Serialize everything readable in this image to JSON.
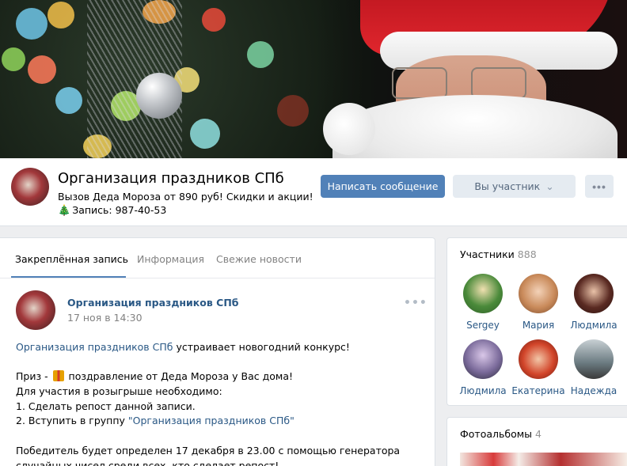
{
  "header": {
    "group_name": "Организация праздников СПб",
    "status": "Вызов Деда Мороза от 890 руб! Скидки и акции!",
    "phone_icon": "🎄",
    "phone": "Запись: 987-40-53",
    "write_button": "Написать сообщение",
    "member_button": "Вы участник",
    "member_chevron": "⌄",
    "more_button": "•••"
  },
  "tabs": [
    {
      "label": "Закреплённая запись",
      "active": true
    },
    {
      "label": "Информация",
      "active": false
    },
    {
      "label": "Свежие новости",
      "active": false
    }
  ],
  "post": {
    "author": "Организация праздников СПб",
    "date": "17 ноя в 14:30",
    "more": "•••",
    "line1_link": "Организация праздников СПб",
    "line1_rest": " устраивает новогодний конкурс!",
    "line2_a": "Приз - ",
    "line2_b": " поздравление от Деда Мороза у Вас дома!",
    "line3": "Для участия в розыгрыше необходимо:",
    "line4": "1. Сделать репост данной записи.",
    "line5_a": "2. Вступить в группу ",
    "line5_link": "\"Организация праздников СПб\"",
    "line6": "Победитель будет определен 17 декабря в 23.00 с помощью генератора",
    "line7": "случайных чисел среди всех, кто сделает репост!"
  },
  "members": {
    "title": "Участники",
    "count": "888",
    "list": [
      {
        "name": "Sergey",
        "color": "#4a8a3a"
      },
      {
        "name": "Мария",
        "color": "#c98a5a"
      },
      {
        "name": "Людмила",
        "color": "#5a2a22"
      },
      {
        "name": "Людмила",
        "color": "#7a6a9a"
      },
      {
        "name": "Екатерина",
        "color": "#d2452a"
      },
      {
        "name": "Надежда",
        "color": "#6a7a80"
      }
    ]
  },
  "albums": {
    "title": "Фотоальбомы",
    "count": "4"
  },
  "colors": {
    "accent": "#5181b8",
    "link": "#2a5885",
    "muted": "#828282",
    "background": "#edeef0"
  }
}
